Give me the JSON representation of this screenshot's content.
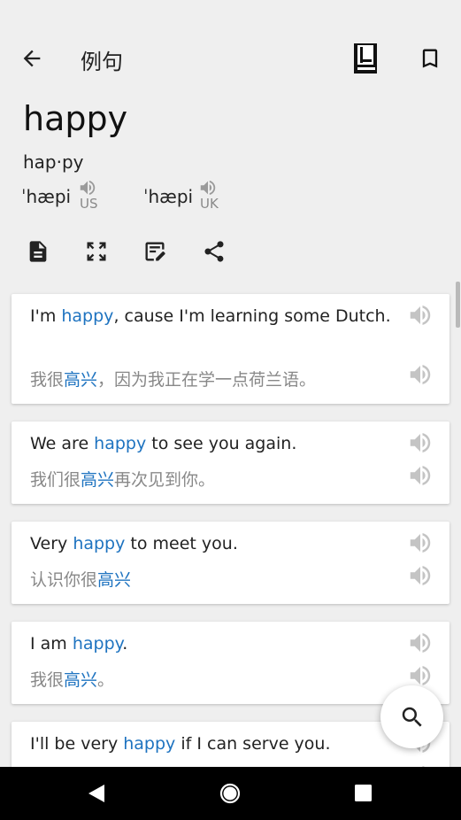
{
  "header": {
    "title": "例句",
    "word": "happy",
    "syllables": "hap·py",
    "pron_us": "ˈhæpi",
    "label_us": "US",
    "pron_uk": "ˈhæpi",
    "label_uk": "UK"
  },
  "icons": {
    "back": "arrow-back-icon",
    "book": "dictionary-book-icon",
    "bookmark": "bookmark-icon",
    "document": "document-icon",
    "fullscreen": "fullscreen-icon",
    "edit": "edit-note-icon",
    "share": "share-icon",
    "volume": "volume-icon",
    "search": "search-icon"
  },
  "colors": {
    "highlight": "#1e73c0",
    "background": "#efefef",
    "card": "#ffffff"
  },
  "sentences": [
    {
      "en": {
        "before": "I'm ",
        "hl": "happy",
        "after": ", cause I'm learning some Dutch."
      },
      "zh": {
        "before": "我很",
        "hl": "高兴",
        "after": "，因为我正在学一点荷兰语。"
      }
    },
    {
      "en": {
        "before": "We are ",
        "hl": "happy",
        "after": " to see you again."
      },
      "zh": {
        "before": "我们很",
        "hl": "高兴",
        "after": "再次见到你。"
      }
    },
    {
      "en": {
        "before": "Very ",
        "hl": "happy",
        "after": " to meet you."
      },
      "zh": {
        "before": "认识你很",
        "hl": "高兴",
        "after": ""
      }
    },
    {
      "en": {
        "before": "I am ",
        "hl": "happy",
        "after": "."
      },
      "zh": {
        "before": "我很",
        "hl": "高兴",
        "after": "。"
      }
    },
    {
      "en": {
        "before": "I'll be very ",
        "hl": "happy",
        "after": " if I can serve you."
      },
      "zh": {
        "before": "",
        "hl": "",
        "after": ""
      }
    }
  ]
}
